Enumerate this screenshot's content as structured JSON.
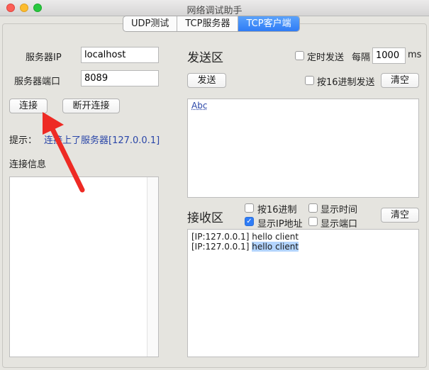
{
  "window": {
    "title": "网络调试助手"
  },
  "tabs": [
    {
      "label": "UDP测试"
    },
    {
      "label": "TCP服务器"
    },
    {
      "label": "TCP客户端"
    }
  ],
  "connection": {
    "server_ip_label": "服务器IP",
    "server_ip_value": "localhost",
    "server_port_label": "服务器端口",
    "server_port_value": "8089",
    "connect_label": "连接",
    "disconnect_label": "断开连接",
    "hint_label": "提示：",
    "hint_value": "连接上了服务器[127.0.0.1]",
    "info_label": "连接信息"
  },
  "send": {
    "title": "发送区",
    "timed_send_label": "定时发送",
    "interval_label": "每隔",
    "interval_value": "1000",
    "interval_unit": "ms",
    "send_button": "发送",
    "hex_send_label": "按16进制发送",
    "clear_label": "清空",
    "text": "Abc"
  },
  "receive": {
    "title": "接收区",
    "hex_label": "按16进制",
    "show_time_label": "显示时间",
    "show_ip_label": "显示IP地址",
    "show_port_label": "显示端口",
    "clear_label": "清空",
    "lines": [
      {
        "prefix": "[IP:127.0.0.1]",
        "message": "hello client"
      },
      {
        "prefix": "[IP:127.0.0.1]",
        "message": "hello client"
      }
    ]
  },
  "colors": {
    "accent": "#2f7cf6",
    "annotation_arrow": "#ee2a24"
  }
}
